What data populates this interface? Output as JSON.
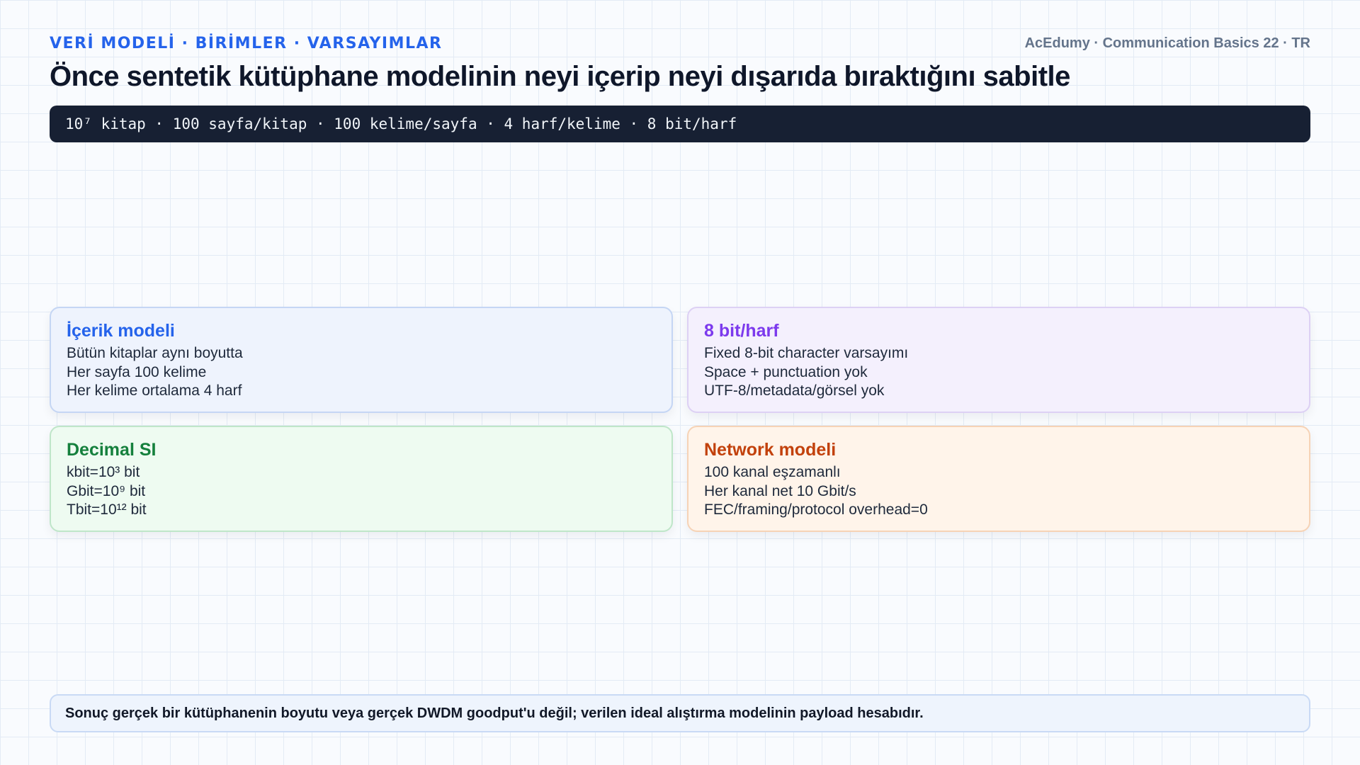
{
  "header": {
    "kicker": "VERİ MODELİ · BİRİMLER · VARSAYIMLAR",
    "brand": "AcEdumy · Communication Basics 22 · TR",
    "title": "Önce sentetik kütüphane modelinin neyi içerip neyi dışarıda bıraktığını sabitle"
  },
  "formula": "10⁷ kitap · 100 sayfa/kitap · 100 kelime/sayfa · 4 harf/kelime · 8 bit/harf",
  "cards": [
    {
      "title": "İçerik modeli",
      "lines": [
        "Bütün kitaplar aynı boyutta",
        "Her sayfa 100 kelime",
        "Her kelime ortalama 4 harf"
      ],
      "accent": "#2563eb"
    },
    {
      "title": "8 bit/harf",
      "lines": [
        "Fixed 8-bit character varsayımı",
        "Space + punctuation yok",
        "UTF-8/metadata/görsel yok"
      ],
      "accent": "#7c3aed"
    },
    {
      "title": "Decimal SI",
      "lines": [
        "kbit=10³ bit",
        "Gbit=10⁹ bit",
        "Tbit=10¹² bit"
      ],
      "accent": "#15803d"
    },
    {
      "title": "Network modeli",
      "lines": [
        "100 kanal eşzamanlı",
        "Her kanal net 10 Gbit/s",
        "FEC/framing/protocol overhead=0"
      ],
      "accent": "#c2410c"
    }
  ],
  "note": "Sonuç gerçek bir kütüphanenin boyutu veya gerçek DWDM goodput'u değil; verilen ideal alıştırma modelinin payload hesabıdır."
}
